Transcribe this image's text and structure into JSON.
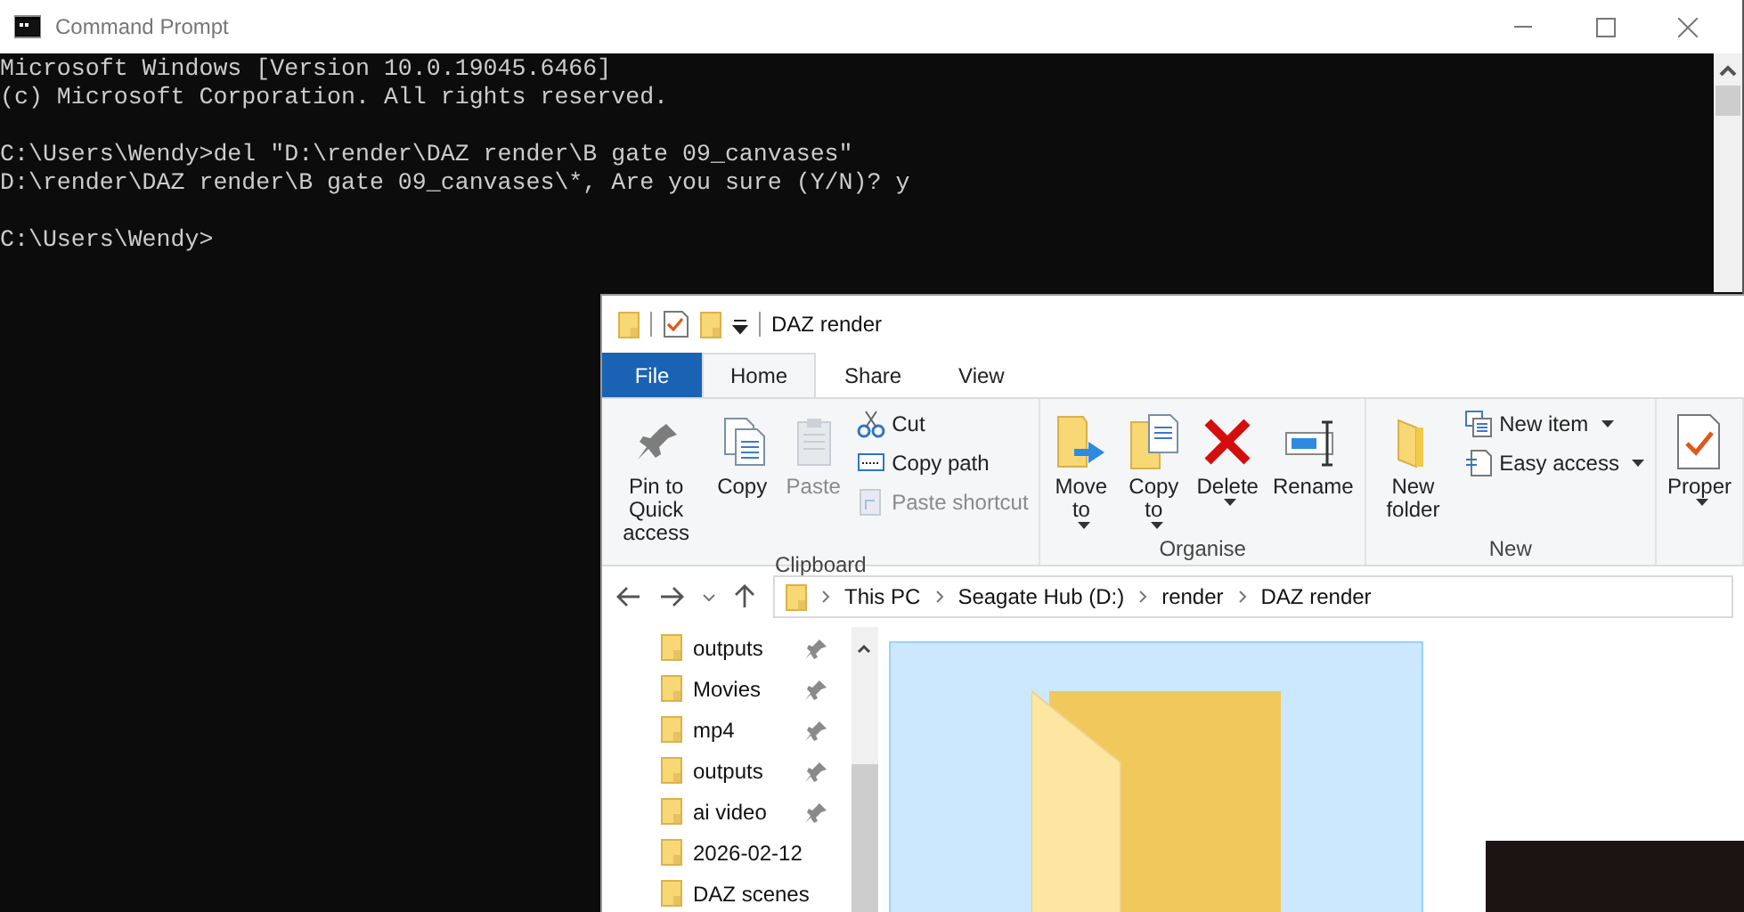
{
  "console": {
    "title": "Command Prompt",
    "blocks": [
      [
        "Microsoft Windows [Version 10.0.19045.6466]",
        "(c) Microsoft Corporation. All rights reserved."
      ],
      [
        "C:\\Users\\Wendy>del \"D:\\render\\DAZ render\\B gate 09_canvases\"",
        "D:\\render\\DAZ render\\B gate 09_canvases\\*, Are you sure (Y/N)? y"
      ],
      [
        "C:\\Users\\Wendy>"
      ]
    ]
  },
  "explorer": {
    "title": "DAZ render",
    "tabs": [
      {
        "label": "File",
        "kind": "file",
        "selected": false
      },
      {
        "label": "Home",
        "kind": "tab",
        "selected": true
      },
      {
        "label": "Share",
        "kind": "tab",
        "selected": false
      },
      {
        "label": "View",
        "kind": "tab",
        "selected": false
      }
    ],
    "ribbon_groups": [
      {
        "label": "Clipboard",
        "buttons": [
          {
            "label": "Pin to Quick access",
            "kind": "large",
            "disabled": false,
            "dropdown": false
          },
          {
            "label": "Copy",
            "kind": "large",
            "disabled": false,
            "dropdown": false
          },
          {
            "label": "Paste",
            "kind": "large",
            "disabled": true,
            "dropdown": false
          },
          {
            "label": "Cut",
            "kind": "small",
            "disabled": false,
            "dropdown": false
          },
          {
            "label": "Copy path",
            "kind": "small",
            "disabled": false,
            "dropdown": false
          },
          {
            "label": "Paste shortcut",
            "kind": "small",
            "disabled": true,
            "dropdown": false
          }
        ]
      },
      {
        "label": "Organise",
        "buttons": [
          {
            "label": "Move to",
            "kind": "large",
            "disabled": false,
            "dropdown": true
          },
          {
            "label": "Copy to",
            "kind": "large",
            "disabled": false,
            "dropdown": true
          },
          {
            "label": "Delete",
            "kind": "large",
            "disabled": false,
            "dropdown": true
          },
          {
            "label": "Rename",
            "kind": "large",
            "disabled": false,
            "dropdown": false
          }
        ]
      },
      {
        "label": "New",
        "buttons": [
          {
            "label": "New folder",
            "kind": "large",
            "disabled": false,
            "dropdown": false
          },
          {
            "label": "New item",
            "kind": "small",
            "disabled": false,
            "dropdown": true
          },
          {
            "label": "Easy access",
            "kind": "small",
            "disabled": false,
            "dropdown": true
          }
        ]
      },
      {
        "buttons": [
          {
            "label": "Proper",
            "kind": "large",
            "disabled": false,
            "dropdown": true
          }
        ]
      }
    ],
    "address": [
      "This PC",
      "Seagate Hub (D:)",
      "render",
      "DAZ render"
    ],
    "nav_items": [
      {
        "label": "outputs",
        "pinned": true
      },
      {
        "label": "Movies",
        "pinned": true
      },
      {
        "label": "mp4",
        "pinned": true
      },
      {
        "label": "outputs",
        "pinned": true
      },
      {
        "label": "ai video",
        "pinned": true
      },
      {
        "label": "2026-02-12",
        "pinned": false
      },
      {
        "label": "DAZ scenes",
        "pinned": false
      }
    ],
    "items": [
      {
        "kind": "folder",
        "selected": true
      },
      {
        "kind": "image",
        "selected": false
      }
    ]
  }
}
